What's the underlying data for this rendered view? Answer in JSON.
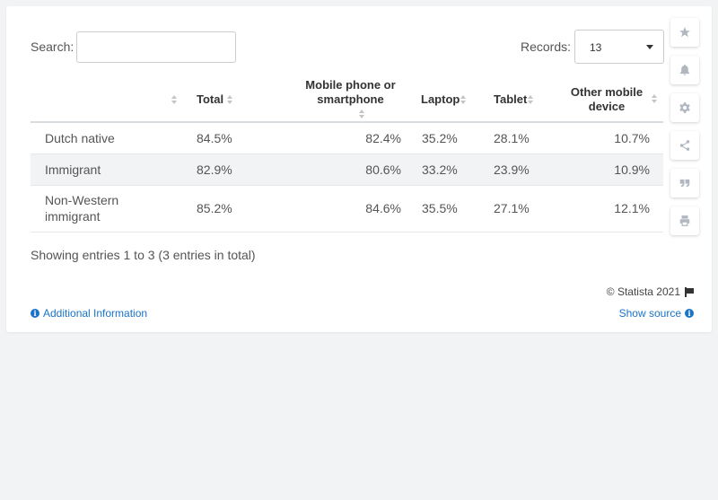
{
  "search": {
    "label": "Search:",
    "value": ""
  },
  "records": {
    "label": "Records:",
    "selected": "13"
  },
  "table": {
    "headers": [
      "",
      "Total",
      "Mobile phone or smartphone",
      "Laptop",
      "Tablet",
      "Other mobile device"
    ],
    "rows": [
      [
        "Dutch native",
        "84.5%",
        "82.4%",
        "35.2%",
        "28.1%",
        "10.7%"
      ],
      [
        "Immigrant",
        "82.9%",
        "80.6%",
        "33.2%",
        "23.9%",
        "10.9%"
      ],
      [
        "Non-Western immigrant",
        "85.2%",
        "84.6%",
        "35.5%",
        "27.1%",
        "12.1%"
      ]
    ]
  },
  "footer": {
    "showing": "Showing entries 1 to 3 (3 entries in total)",
    "copyright": "© Statista 2021",
    "additional_info": "Additional Information",
    "show_source": "Show source"
  },
  "sidebar_icons": [
    "star-icon",
    "bell-icon",
    "gear-icon",
    "share-icon",
    "quote-icon",
    "print-icon"
  ],
  "colors": {
    "link": "#1a73c7",
    "stripe": "#f1f3f5",
    "icon": "#b0b7bf"
  }
}
